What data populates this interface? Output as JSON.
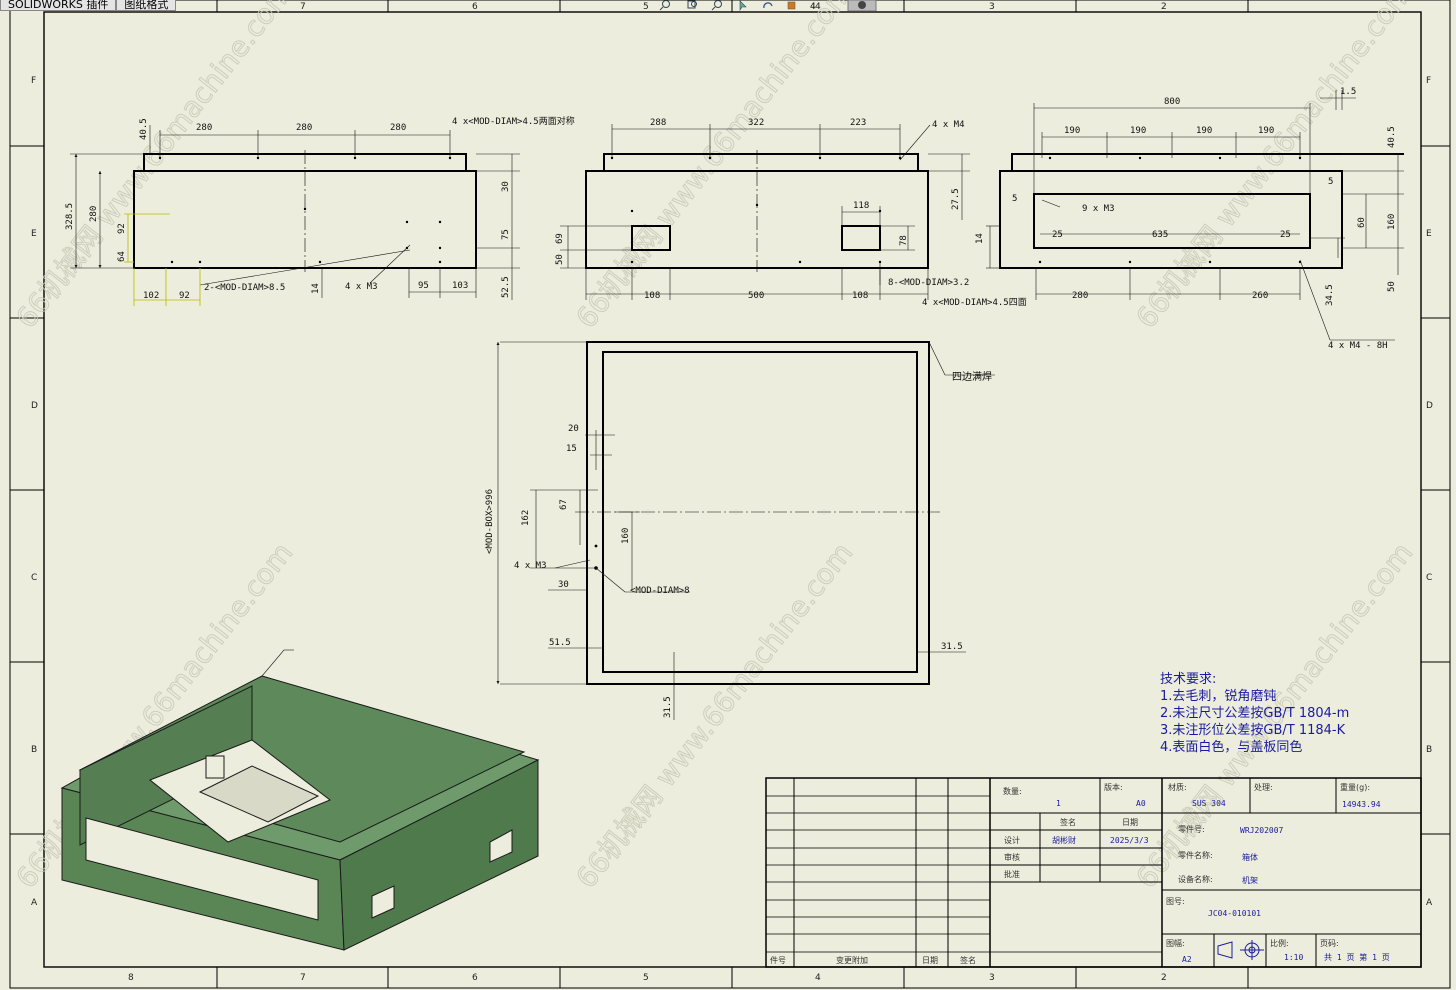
{
  "tabs": [
    "SOLIDWORKS 插件",
    "图纸格式"
  ],
  "toolbar_icons": [
    "zoom-fit-icon",
    "zoom-area-icon",
    "zoom-in-icon",
    "select-icon",
    "rotate-icon",
    "view-orient-icon",
    "display-style-icon"
  ],
  "border_columns_top": [
    "7",
    "6",
    "5",
    "4",
    "3",
    "2"
  ],
  "border_columns_bottom": [
    "8",
    "7",
    "6",
    "5",
    "4",
    "3",
    "2"
  ],
  "border_rows": [
    "F",
    "E",
    "D",
    "C",
    "B",
    "A"
  ],
  "watermark": "66机械网 www.66machine.com",
  "front_view": {
    "dims": [
      "280",
      "280",
      "280",
      "40.5",
      "4 x<MOD-DIAM>4.5两面对称",
      "328.5",
      "280",
      "30",
      "75",
      "52.5",
      "92",
      "64",
      "102",
      "92",
      "2-<MOD-DIAM>8.5",
      "14",
      "4 x M3",
      "95",
      "103"
    ]
  },
  "side_view": {
    "dims": [
      "288",
      "322",
      "223",
      "4 x M4",
      "27.5",
      "118",
      "78",
      "69",
      "50",
      "108",
      "500",
      "108",
      "8-<MOD-DIAM>3.2",
      "4 x<MOD-DIAM>4.5四面"
    ]
  },
  "right_view": {
    "dims": [
      "800",
      "1.5",
      "190",
      "190",
      "190",
      "190",
      "40.5",
      "5",
      "5",
      "9 x M3",
      "25",
      "635",
      "25",
      "14",
      "60",
      "160",
      "280",
      "260",
      "34.5",
      "50",
      "4 x M4 - 8H"
    ]
  },
  "top_view": {
    "dims": [
      "<MOD-BOX>996",
      "20",
      "15",
      "67",
      "162",
      "160",
      "4 x M3",
      "<MOD-DIAM>8",
      "30",
      "51.5",
      "31.5",
      "31.5"
    ],
    "note": "四边满焊"
  },
  "tech_requirements": {
    "title": "技术要求:",
    "items": [
      "1.去毛刺，锐角磨钝",
      "2.未注尺寸公差按GB/T 1804-m",
      "3.未注形位公差按GB/T 1184-K",
      "4.表面白色，与盖板同色"
    ]
  },
  "title_block": {
    "qty_label": "数量:",
    "qty": "1",
    "version_label": "版本:",
    "version": "A0",
    "material_label": "材质:",
    "material": "SUS 304",
    "treatment_label": "处理:",
    "weight_label": "重量(g):",
    "weight": "14943.94",
    "sign_label": "签名",
    "date_label": "日期",
    "design_label": "设计",
    "designer": "胡彬财",
    "design_date": "2025/3/3",
    "review_label": "审核",
    "approve_label": "批准",
    "part_no_label": "零件号:",
    "part_no": "WRJ202007",
    "part_name_label": "零件名称:",
    "part_name": "箱体",
    "equip_label": "设备名称:",
    "equip_name": "机架",
    "drawing_no_label": "图号:",
    "drawing_no": "JC04-010101",
    "size_label": "图幅:",
    "size": "A2",
    "scale_label": "比例:",
    "scale": "1:10",
    "page_label": "页码:",
    "page": "共 1 页    第 1 页",
    "rev_mark_label": "件号",
    "change_file_label": "变更附加",
    "rev_date_label": "日期",
    "rev_sign_label": "签名"
  },
  "colors": {
    "paper": "#ededdd",
    "line": "#000000",
    "dim": "#111111",
    "blue_text": "#1a1aa0",
    "model_fill": "#5e8a5b",
    "highlight_dim": "#b8b800"
  }
}
